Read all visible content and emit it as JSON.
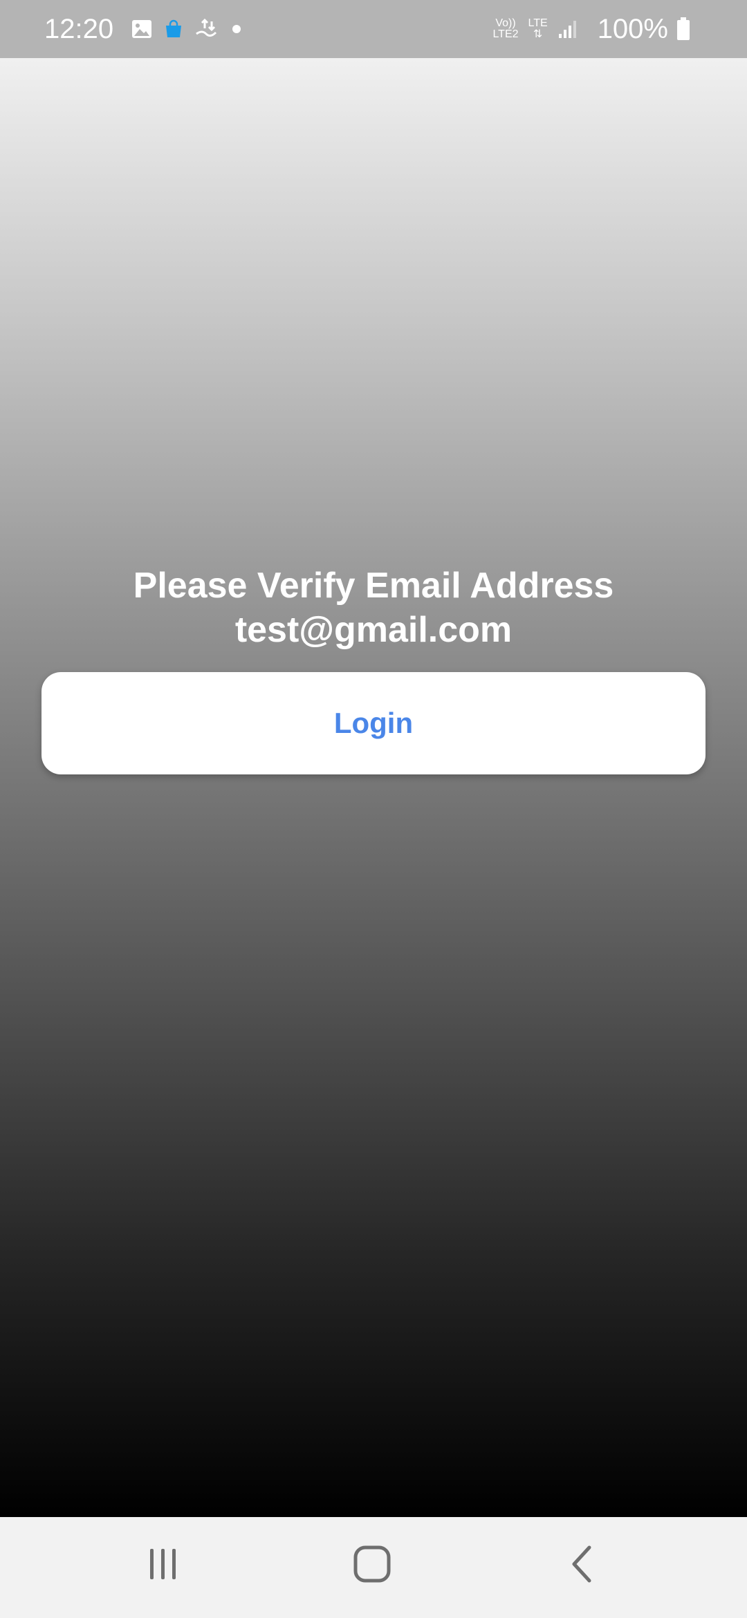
{
  "status_bar": {
    "time": "12:20",
    "network_label_top": "Vo))",
    "network_label_bottom": "LTE2",
    "lte_label": "LTE",
    "battery": "100%",
    "icons": [
      "gallery-icon",
      "shopping-bag-icon",
      "data-transfer-icon",
      "dot-icon",
      "signal-icon",
      "battery-icon"
    ],
    "accent_color": "#1a9be8"
  },
  "main": {
    "title": "Please Verify Email Address",
    "email": "test@gmail.com"
  },
  "login_button": {
    "label": "Login",
    "color": "#4a86e8"
  },
  "nav_bar": {
    "icons": [
      "recent-apps-icon",
      "home-icon",
      "back-icon"
    ]
  }
}
